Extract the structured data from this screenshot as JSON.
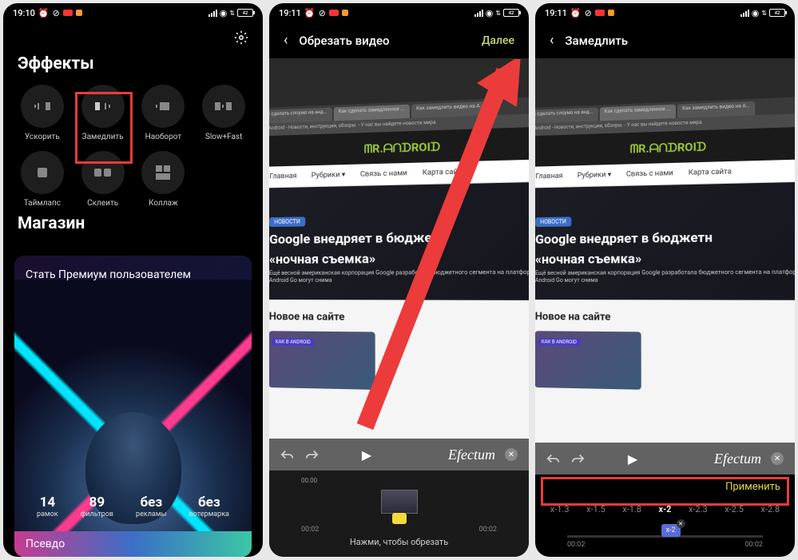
{
  "screen1": {
    "status": {
      "time": "19:10",
      "battery": "42"
    },
    "effects_title": "Эффекты",
    "effects": [
      {
        "label": "Ускорить"
      },
      {
        "label": "Замедлить"
      },
      {
        "label": "Наоборот"
      },
      {
        "label": "Slow+Fast"
      },
      {
        "label": "Таймлапс"
      },
      {
        "label": "Склеить"
      },
      {
        "label": "Коллаж"
      }
    ],
    "store_title": "Магазин",
    "premium": "Стать Премиум пользователем",
    "stats": [
      {
        "num": "14",
        "label": "рамок"
      },
      {
        "num": "89",
        "label": "фильтров"
      },
      {
        "num": "без",
        "label": "рекламы"
      },
      {
        "num": "без",
        "label": "вотермарка"
      }
    ],
    "pseudo": "Псевдо"
  },
  "screen2": {
    "status": {
      "time": "19:11",
      "battery": "42"
    },
    "title": "Обрезать видео",
    "next": "Далее",
    "brand": "Efectum",
    "time_tick": "00.00",
    "time_start": "00:02",
    "time_end": "00:02",
    "hint": "Нажми, чтобы обрезать",
    "page": {
      "logo": "ᗰR.ᗩᑎᗪROIᗪ",
      "address": "Mr. Android - Новости, инструкции, обзоры. - У нас вы найдете новости мира",
      "nav": [
        "Главная",
        "Рубрики ▾",
        "Связь с нами",
        "Карта сайта"
      ],
      "tabs": [
        "Как сделать слоумо на анд...",
        "Как сделать замедленное ...",
        "Как замедлить видео на А..."
      ],
      "hero_badge": "НОВОСТИ",
      "hero_title_a": "Google внедряет в бюджетн",
      "hero_title_b": "«ночная съемка»",
      "hero_sub": "Ещё весной американская корпорация Google разработала бюджетного сегмента на платформе Android Go могут снима",
      "section": "Новое на сайте",
      "thumb_badge": "КАК В ANDROID"
    }
  },
  "screen3": {
    "status": {
      "time": "19:11",
      "battery": "42"
    },
    "title": "Замедлить",
    "brand": "Efectum",
    "apply": "Применить",
    "speeds": [
      "x-1.3",
      "x-1.5",
      "x-1.8",
      "x-2",
      "x-2.3",
      "x-2.5",
      "x-2.8"
    ],
    "active_speed": "x-2",
    "time_start": "00:02",
    "time_end": "00:02",
    "page": {
      "logo": "ᗰR.ᗩᑎᗪROIᗪ",
      "address": "Mr. Android - Новости, инструкции, обзоры. - У нас вы найдете новости мира",
      "nav": [
        "Главная",
        "Рубрики ▾",
        "Связь с нами",
        "Карта сайта"
      ],
      "tabs": [
        "Как сделать слоумо на анд...",
        "Как сделать замедленное ...",
        "Как замедлить видео на А..."
      ],
      "hero_badge": "НОВОСТИ",
      "hero_title_a": "Google внедряет в бюджетн",
      "hero_title_b": "«ночная съемка»",
      "hero_sub": "Ещё весной американская корпорация Google разработала бюджетного сегмента на платформе Android Go могут снима",
      "section": "Новое на сайте",
      "thumb_badge": "КАК В ANDROID"
    }
  }
}
